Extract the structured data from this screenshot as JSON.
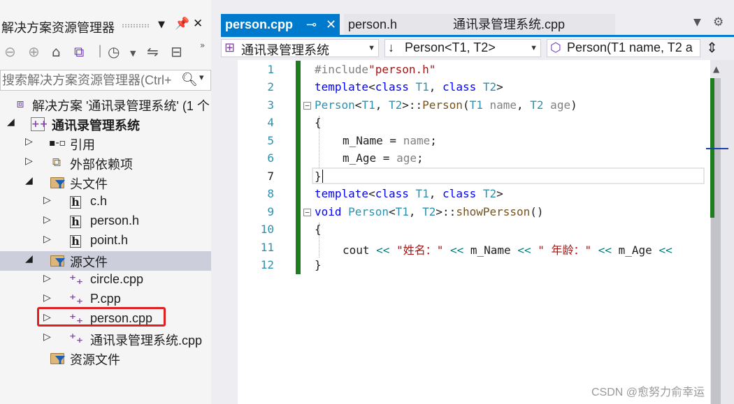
{
  "solution_explorer": {
    "title": "解决方案资源管理器",
    "search_placeholder": "搜索解决方案资源管理器(Ctrl+",
    "tree": [
      {
        "label": "解决方案 '通讯录管理系统' (1 个"
      },
      {
        "label": "通讯录管理系统"
      },
      {
        "label": "引用"
      },
      {
        "label": "外部依赖项"
      },
      {
        "label": "头文件"
      },
      {
        "label": "c.h"
      },
      {
        "label": "person.h"
      },
      {
        "label": "point.h"
      },
      {
        "label": "源文件"
      },
      {
        "label": "circle.cpp"
      },
      {
        "label": "P.cpp"
      },
      {
        "label": "person.cpp"
      },
      {
        "label": "通讯录管理系统.cpp"
      },
      {
        "label": "资源文件"
      }
    ]
  },
  "editor": {
    "tabs": [
      {
        "label": "person.cpp"
      },
      {
        "label": "person.h"
      },
      {
        "label": "通讯录管理系统.cpp"
      }
    ],
    "nav": {
      "project": "通讯录管理系统",
      "scope": "Person<T1, T2>",
      "member": "Person(T1 name, T2 a"
    },
    "line_numbers": [
      "1",
      "2",
      "3",
      "4",
      "5",
      "6",
      "7",
      "8",
      "9",
      "10",
      "11",
      "12"
    ],
    "code": {
      "l1_pp": "#include",
      "l1_str": "\"person.h\"",
      "l2_kw1": "template",
      "l2_rest1": "<",
      "l2_kw2": "class",
      "l2_t1": "T1",
      "l2_rest2": ", ",
      "l2_kw3": "class",
      "l2_t2": "T2",
      "l2_rest3": ">",
      "l3_ty": "Person",
      "l3_a": "<",
      "l3_t1": "T1",
      "l3_b": ", ",
      "l3_t2": "T2",
      "l3_c": ">::",
      "l3_fn": "Person",
      "l3_d": "(",
      "l3_t3": "T1",
      "l3_p1": " name",
      "l3_e": ", ",
      "l3_t4": "T2",
      "l3_p2": " age",
      "l3_f": ")",
      "l4": "{",
      "l5_a": "m_Name = ",
      "l5_p": "name",
      "l5_b": ";",
      "l6_a": "m_Age = ",
      "l6_p": "age",
      "l6_b": ";",
      "l7": "}",
      "l8_kw1": "template",
      "l8_rest1": "<",
      "l8_kw2": "class",
      "l8_t1": "T1",
      "l8_rest2": ", ",
      "l8_kw3": "class",
      "l8_t2": "T2",
      "l8_rest3": ">",
      "l9_kw": "void",
      "l9_ty": "Person",
      "l9_a": "<",
      "l9_t1": "T1",
      "l9_b": ", ",
      "l9_t2": "T2",
      "l9_c": ">::",
      "l9_fn": "showPersson",
      "l9_d": "()",
      "l10": "{",
      "l11_a": "cout ",
      "l11_op1": "<<",
      "l11_s1": " \"姓名：\" ",
      "l11_op2": "<<",
      "l11_b": " m_Name ",
      "l11_op3": "<<",
      "l11_s2": " \" 年龄：\" ",
      "l11_op4": "<<",
      "l11_c": " m_Age ",
      "l11_op5": "<<",
      "l12": "}"
    }
  },
  "watermark": "CSDN @愈努力俞幸运"
}
